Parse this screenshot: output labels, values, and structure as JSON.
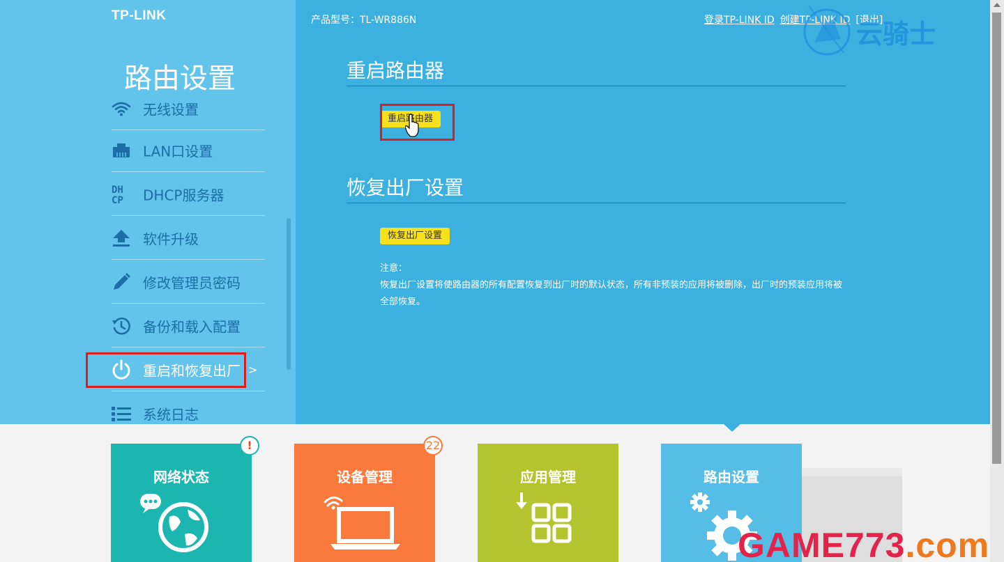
{
  "brand": "TP-LINK",
  "header": {
    "model_label": "产品型号：TL-WR886N",
    "login_link": "登录TP-LINK ID",
    "create_link": "创建TP-LINK ID",
    "logout_link": "[退出]"
  },
  "sidebar": {
    "title": "路由设置",
    "items": [
      {
        "label": "无线设置",
        "icon": "wifi-icon"
      },
      {
        "label": "LAN口设置",
        "icon": "ethernet-icon"
      },
      {
        "label": "DHCP服务器",
        "icon": "dhcp-icon"
      },
      {
        "label": "软件升级",
        "icon": "upload-icon"
      },
      {
        "label": "修改管理员密码",
        "icon": "pencil-icon"
      },
      {
        "label": "备份和载入配置",
        "icon": "history-icon"
      },
      {
        "label": "重启和恢复出厂",
        "icon": "power-icon",
        "active": true
      },
      {
        "label": "系统日志",
        "icon": "list-icon"
      }
    ],
    "active_chevron": ">"
  },
  "main": {
    "reboot_section": {
      "title": "重启路由器",
      "button": "重启路由器"
    },
    "reset_section": {
      "title": "恢复出厂设置",
      "button": "恢复出厂设置",
      "note_title": "注意：",
      "note_text": "恢复出厂设置将使路由器的所有配置恢复到出厂时的默认状态，所有非预装的应用将被删除，出厂时的预装应用将被全部恢复。"
    }
  },
  "tiles": [
    {
      "label": "网络状态",
      "color": "#1cb6b1",
      "badge": "!",
      "badge_color": "#e14d2a",
      "icon": "globe-chat-icon"
    },
    {
      "label": "设备管理",
      "color": "#fa7a3e",
      "badge": "22",
      "badge_color": "#fa7a3e",
      "icon": "laptop-wifi-icon"
    },
    {
      "label": "应用管理",
      "color": "#b4c42e",
      "icon": "apps-grid-icon"
    },
    {
      "label": "路由设置",
      "color": "#55bde6",
      "icon": "gear-icon",
      "active": true
    }
  ],
  "watermarks": {
    "top": "云骑士",
    "bottom_main": "GAME773",
    "bottom_suffix": ".com"
  },
  "colors": {
    "sidebar_bg": "#62c3eb",
    "main_bg": "#3cb0de",
    "button_yellow": "#f7e11b",
    "highlight_red": "#d8201e"
  }
}
